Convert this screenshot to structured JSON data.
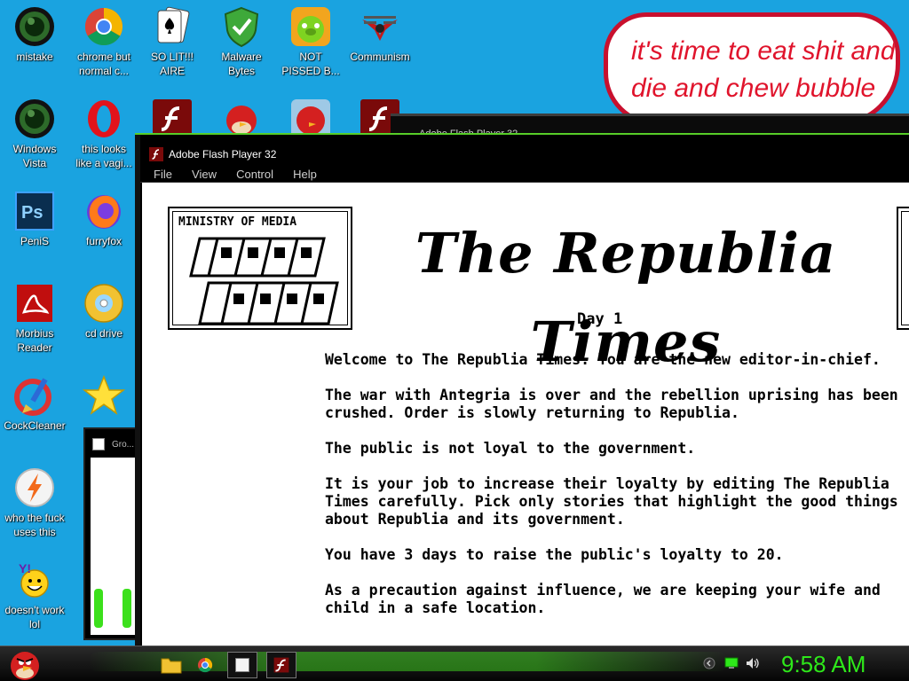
{
  "desktop": {
    "icons": [
      {
        "label": "mistake",
        "icon": "green-orb-icon"
      },
      {
        "label": "chrome but\nnormal c...",
        "icon": "chrome-icon"
      },
      {
        "label": "SO LIT!!!\nAIRE",
        "icon": "solitaire-icon"
      },
      {
        "label": "Malware\nBytes",
        "icon": "shield-check-icon"
      },
      {
        "label": "NOT\nPISSED B...",
        "icon": "pig-icon"
      },
      {
        "label": "Communism",
        "icon": "emblem-icon"
      },
      {
        "label": "Windows\nVista",
        "icon": "green-orb-icon"
      },
      {
        "label": "this looks\nlike a vagi...",
        "icon": "opera-icon"
      },
      {
        "label": "PeniS",
        "icon": "photoshop-icon"
      },
      {
        "label": "furryfox",
        "icon": "firefox-icon"
      },
      {
        "label": "Morbius\nReader",
        "icon": "pdf-reader-icon"
      },
      {
        "label": "cd drive",
        "icon": "cd-icon"
      },
      {
        "label": "CockCleaner",
        "icon": "ccleaner-icon"
      },
      {
        "label": "who the fuck\nuses this",
        "icon": "lightning-icon"
      },
      {
        "label": "doesn't work\nlol",
        "icon": "yahoo-messenger-icon"
      }
    ]
  },
  "bubble": {
    "text": "it's time to eat shit and die and chew bubble gum"
  },
  "back_window": {
    "title": "Adobe Flash Player 32"
  },
  "flash_window": {
    "title": "Adobe Flash Player 32",
    "menu": [
      "File",
      "View",
      "Control",
      "Help"
    ]
  },
  "game": {
    "ministry_label": "MINISTRY OF MEDIA",
    "masthead": "The Republia Times",
    "day": "Day 1",
    "paragraphs": [
      "Welcome to The Republia Times. You are the new editor-in-chief.",
      "The war with Antegria is over and the rebellion uprising has been crushed. Order is slowly returning to Republia.",
      "The public is not loyal to the government.",
      "It is your job to increase their loyalty by editing The Republia Times carefully. Pick only stories that highlight the good things about Republia and its government.",
      "You have 3 days to raise the public's loyalty to 20.",
      "As a precaution against influence, we are keeping your wife and child in a safe location."
    ]
  },
  "small_window": {
    "title": "Gro..."
  },
  "taskbar": {
    "start_icon": "angry-bird-icon",
    "pinned": [
      "folder-icon",
      "chrome-icon",
      "window-icon",
      "flash-icon"
    ],
    "clock": "9:58 AM"
  },
  "colors": {
    "desktop_bg": "#1aa3e0",
    "clock": "#2ee81a",
    "bubble_text": "#e0142c",
    "accent_green": "#3ce01c"
  }
}
